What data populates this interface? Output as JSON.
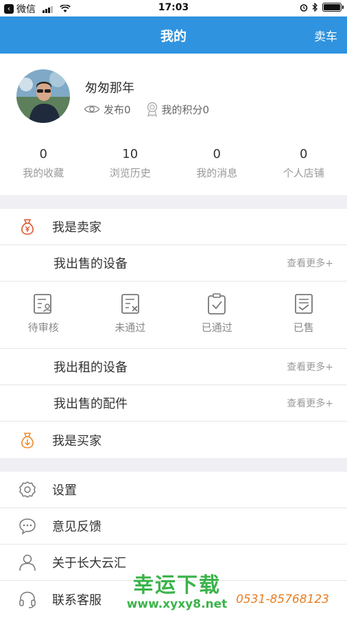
{
  "status_bar": {
    "carrier": "微信",
    "time": "17:03"
  },
  "nav": {
    "title": "我的",
    "action": "卖车"
  },
  "profile": {
    "username": "匆匆那年",
    "publish_label": "发布0",
    "points_label": "我的积分0",
    "stats": [
      {
        "value": "0",
        "label": "我的收藏"
      },
      {
        "value": "10",
        "label": "浏览历史"
      },
      {
        "value": "0",
        "label": "我的消息"
      },
      {
        "value": "0",
        "label": "个人店铺"
      }
    ]
  },
  "seller": {
    "title": "我是卖家",
    "sale_devices": {
      "label": "我出售的设备",
      "more": "查看更多+"
    },
    "statuses": [
      {
        "label": "待审核",
        "icon": "pending-review-icon"
      },
      {
        "label": "未通过",
        "icon": "rejected-icon"
      },
      {
        "label": "已通过",
        "icon": "approved-icon"
      },
      {
        "label": "已售",
        "icon": "sold-icon"
      }
    ],
    "rent_devices": {
      "label": "我出租的设备",
      "more": "查看更多+"
    },
    "sale_parts": {
      "label": "我出售的配件",
      "more": "查看更多+"
    }
  },
  "buyer": {
    "title": "我是买家"
  },
  "menu": [
    {
      "label": "设置",
      "icon": "gear-icon"
    },
    {
      "label": "意见反馈",
      "icon": "chat-bubble-icon"
    },
    {
      "label": "关于长大云汇",
      "icon": "user-icon"
    },
    {
      "label": "联系客服",
      "icon": "headset-icon"
    }
  ],
  "watermark": {
    "title": "幸运下载",
    "url": "www.xyxy8.net",
    "phone": "0531-85768123"
  },
  "colors": {
    "primary": "#2f93e0",
    "seller_icon": "#e0572f",
    "buyer_icon": "#f08a2e",
    "watermark_green": "#3bb34a",
    "watermark_orange": "#e77e22"
  }
}
